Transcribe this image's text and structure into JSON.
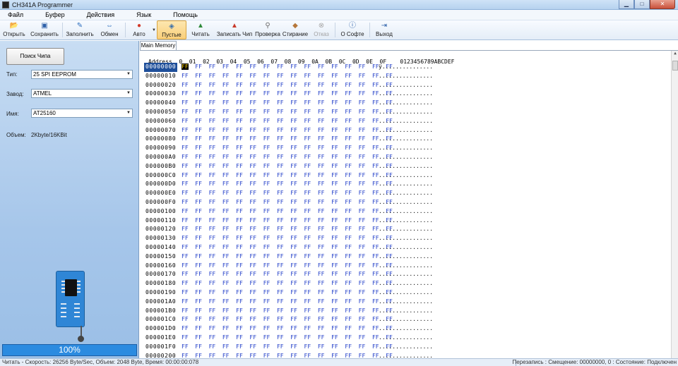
{
  "window": {
    "title": "CH341A Programmer"
  },
  "menu": [
    "Файл",
    "Буфер",
    "Действия",
    "Язык",
    "Помощь"
  ],
  "toolbar": {
    "open": "Открыть",
    "save": "Сохранить",
    "fill": "Заполнить",
    "swap": "Обмен",
    "auto": "Авто",
    "blank": "Пустые",
    "read": "Читать",
    "write": "Записать Чип",
    "verify": "Проверка",
    "erase": "Стирание",
    "cancel": "Отказ",
    "about": "О Софте",
    "exit": "Выход"
  },
  "left": {
    "search_button": "Поиск Чипа",
    "type_label": "Тип:",
    "type_value": "25 SPI EEPROM",
    "vendor_label": "Завод:",
    "vendor_value": "ATMEL",
    "name_label": "Имя:",
    "name_value": "AT25160",
    "volume_label": "Объем:",
    "volume_value": "2Kbyte/16KBit",
    "progress_percent": 100,
    "progress_text": "100%"
  },
  "tab": {
    "label": "Main Memory"
  },
  "hex": {
    "header": "Address  0  01  02  03  04  05  06  07  08  09  0A  0B  0C  0D  0E  0F    0123456789ABCDEF",
    "byte_value": "FF",
    "ascii_value": "................",
    "first_ascii": "ÿ...............",
    "selected_address": "00000000",
    "addresses": [
      "00000000",
      "00000010",
      "00000020",
      "00000030",
      "00000040",
      "00000050",
      "00000060",
      "00000070",
      "00000080",
      "00000090",
      "000000A0",
      "000000B0",
      "000000C0",
      "000000D0",
      "000000E0",
      "000000F0",
      "00000100",
      "00000110",
      "00000120",
      "00000130",
      "00000140",
      "00000150",
      "00000160",
      "00000170",
      "00000180",
      "00000190",
      "000001A0",
      "000001B0",
      "000001C0",
      "000001D0",
      "000001E0",
      "000001F0",
      "00000200"
    ]
  },
  "status": {
    "left": "Читать - Скорость: 26256 Byte/Sec, Объем: 2048 Byte, Время: 00:00:00:078",
    "right": "Перезапись : Смещение: 00000000, 0 : Состояние: Подключен"
  },
  "colors": {
    "hex_bytes": "#1f3cc8",
    "selected_row": "#1f4f9a",
    "progress": "#2b8be0"
  }
}
